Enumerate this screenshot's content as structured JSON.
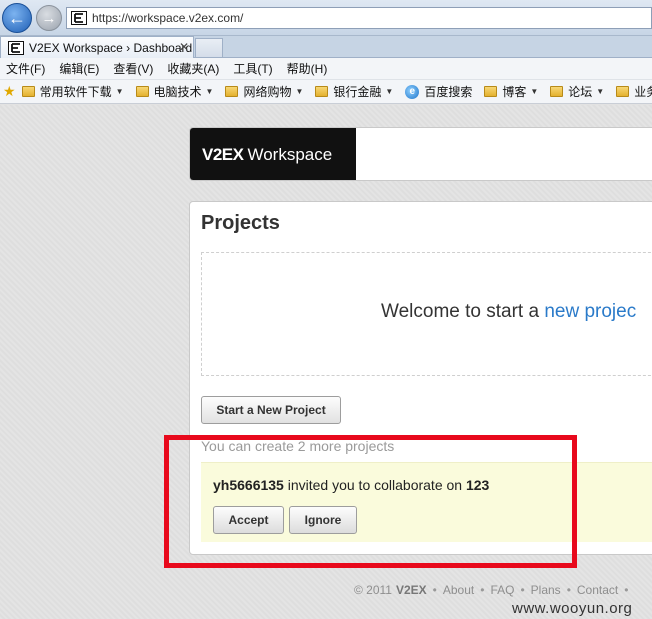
{
  "browser": {
    "address": "https://workspace.v2ex.com/",
    "tab_title": "V2EX Workspace › Dashboard",
    "menu": [
      "文件(F)",
      "编辑(E)",
      "查看(V)",
      "收藏夹(A)",
      "工具(T)",
      "帮助(H)"
    ],
    "favorites": [
      {
        "label": "常用软件下载",
        "icon": "folder-icon",
        "dropdown": true
      },
      {
        "label": "电脑技术",
        "icon": "folder-icon",
        "dropdown": true
      },
      {
        "label": "网络购物",
        "icon": "folder-icon",
        "dropdown": true
      },
      {
        "label": "银行金融",
        "icon": "folder-icon",
        "dropdown": true
      },
      {
        "label": "百度搜索",
        "icon": "ie-icon",
        "dropdown": false
      },
      {
        "label": "博客",
        "icon": "folder-icon",
        "dropdown": true
      },
      {
        "label": "论坛",
        "icon": "folder-icon",
        "dropdown": true
      },
      {
        "label": "业务",
        "icon": "folder-icon",
        "dropdown": false
      }
    ]
  },
  "header": {
    "logo_strong": "V2EX",
    "logo_rest": "Workspace"
  },
  "projects": {
    "title": "Projects",
    "welcome_prefix": "Welcome to start a ",
    "welcome_link": "new projec",
    "start_button": "Start a New Project",
    "remaining": "You can create 2 more projects"
  },
  "invitation": {
    "user": "yh5666135",
    "middle": " invited you to collaborate on ",
    "project": "123",
    "accept_label": "Accept",
    "ignore_label": "Ignore"
  },
  "footer": {
    "copyright": "© 2011",
    "brand": "V2EX",
    "links": [
      "About",
      "FAQ",
      "Plans",
      "Contact"
    ]
  },
  "watermark": "www.wooyun.org",
  "colors": {
    "link": "#2a7ac9",
    "highlight": "#e8091c",
    "invite_bg": "#fafbdc"
  }
}
